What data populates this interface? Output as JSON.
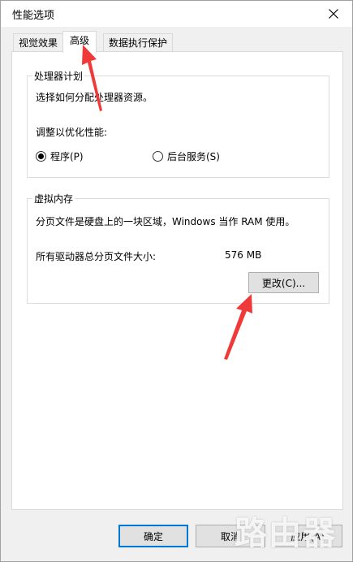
{
  "window": {
    "title": "性能选项"
  },
  "tabs": [
    {
      "label": "视觉效果",
      "active": false
    },
    {
      "label": "高级",
      "active": true
    },
    {
      "label": "数据执行保护",
      "active": false
    }
  ],
  "processor_group": {
    "title": "处理器计划",
    "description": "选择如何分配处理器资源。",
    "adjust_label": "调整以优化性能:",
    "options": [
      {
        "label": "程序(P)",
        "selected": true
      },
      {
        "label": "后台服务(S)",
        "selected": false
      }
    ]
  },
  "virtual_memory_group": {
    "title": "虚拟内存",
    "description": "分页文件是硬盘上的一块区域，Windows 当作 RAM 使用。",
    "total_label": "所有驱动器总分页文件大小:",
    "total_value": "576 MB",
    "change_button": "更改(C)..."
  },
  "footer": {
    "ok_label": "确定",
    "cancel_label": "取消",
    "apply_label": "应用(A)"
  },
  "watermark": {
    "text": "路由器"
  },
  "colors": {
    "annotation_arrow": "#f03a3a",
    "accent": "#0078d7"
  }
}
